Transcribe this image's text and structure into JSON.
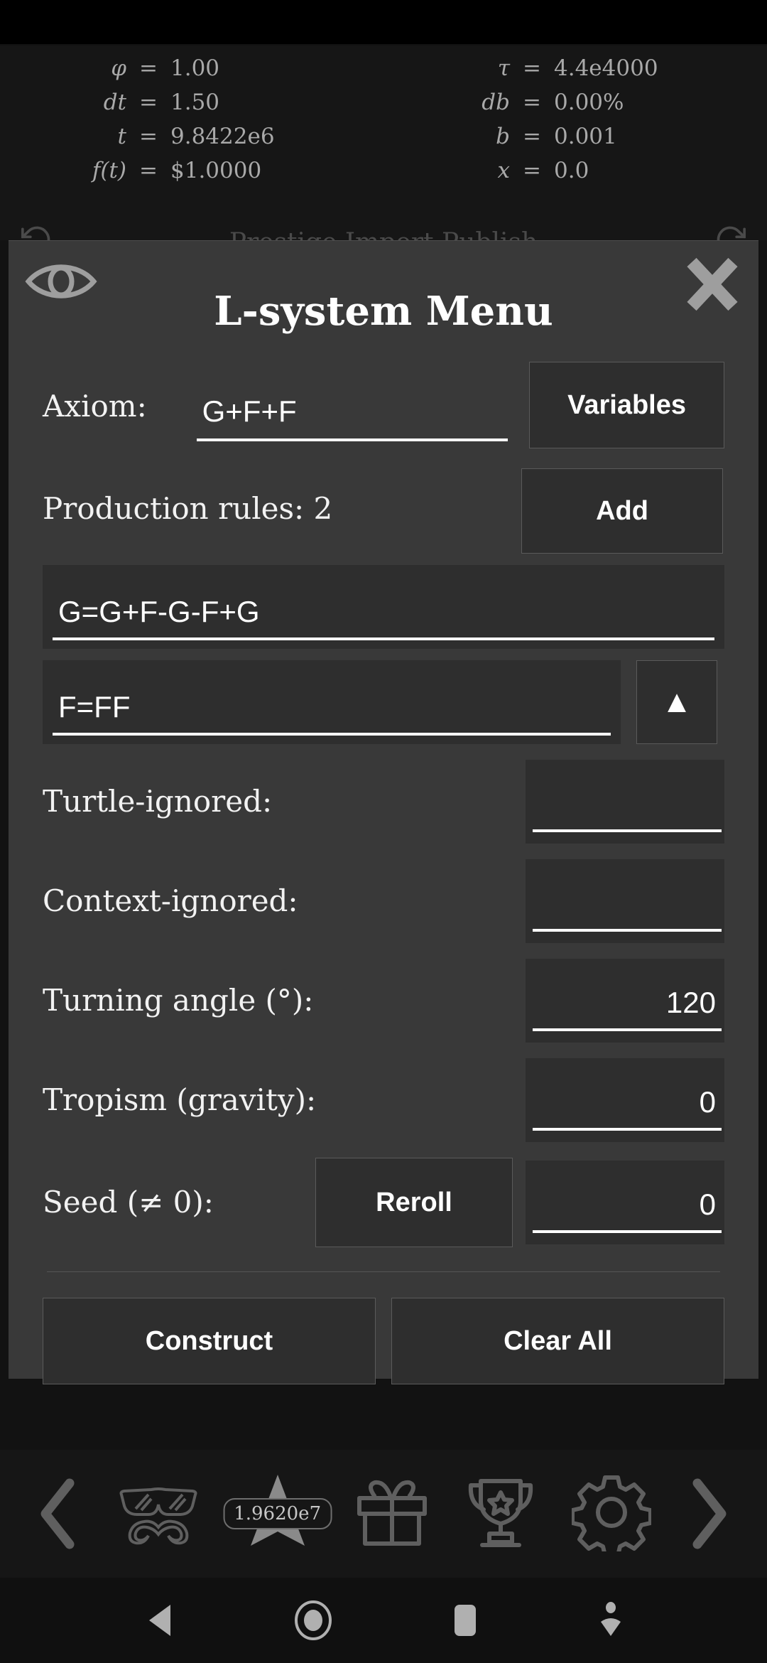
{
  "app": {
    "stats_left": [
      {
        "key": "φ",
        "eq": "=",
        "value": "1.00"
      },
      {
        "key": "dt",
        "eq": "=",
        "value": "1.50"
      },
      {
        "key": "t",
        "eq": "=",
        "value": "9.8422e6"
      },
      {
        "key": "f(t)",
        "eq": "=",
        "value": "$1.0000"
      }
    ],
    "stats_right": [
      {
        "key": "τ",
        "eq": "=",
        "value": "4.4e4000"
      },
      {
        "key": "db",
        "eq": "=",
        "value": "0.00%"
      },
      {
        "key": "b",
        "eq": "=",
        "value": "0.001"
      },
      {
        "key": "x",
        "eq": "=",
        "value": "0.0"
      }
    ],
    "behind_row": {
      "left_icon": "refresh-ccw-icon",
      "text": "Prestige   Import   Publish",
      "right_icon": "refresh-cw-icon"
    }
  },
  "dialog": {
    "title": "L-system Menu",
    "eye_icon": "eye-icon",
    "close_icon": "close-icon",
    "axiom": {
      "label": "Axiom:",
      "value": "G+F+F",
      "placeholder": "",
      "button_label": "Variables"
    },
    "production": {
      "label": "Production rules: 2",
      "add_label": "Add",
      "rules": [
        {
          "value": "G=G+F-G-F+G"
        },
        {
          "value": "F=FF"
        }
      ],
      "collapse_label": "▲"
    },
    "settings": [
      {
        "label": "Turtle-ignored:",
        "value": "",
        "align": "left"
      },
      {
        "label": "Context-ignored:",
        "value": "",
        "align": "left"
      },
      {
        "label": "Turning angle (°):",
        "value": "120",
        "align": "right"
      },
      {
        "label": "Tropism (gravity):",
        "value": "0",
        "align": "right"
      }
    ],
    "seed": {
      "label": "Seed (≠ 0):",
      "button_label": "Reroll",
      "value": "0"
    },
    "actions": {
      "construct_label": "Construct",
      "clear_label": "Clear All"
    }
  },
  "bottom_nav": {
    "prev_icon": "chevron-left-icon",
    "next_icon": "chevron-right-icon",
    "items": [
      {
        "icon": "glasses-mustache-icon",
        "badge": ""
      },
      {
        "icon": "star-icon",
        "badge": "1.9620e7"
      },
      {
        "icon": "gift-icon",
        "badge": ""
      },
      {
        "icon": "trophy-icon",
        "badge": ""
      },
      {
        "icon": "gear-icon",
        "badge": ""
      }
    ]
  },
  "system_nav": {
    "back_icon": "back-triangle-icon",
    "home_icon": "home-circle-icon",
    "recents_icon": "recents-square-icon",
    "dismiss_icon": "keyboard-dismiss-icon"
  },
  "colors": {
    "dialog_bg": "#393939",
    "field_bg": "#2e2e2e",
    "page_bg": "#121212",
    "accent_text": "#ffffff",
    "muted_text": "#a9a9a9",
    "icon_gray": "#5f5f5f"
  }
}
